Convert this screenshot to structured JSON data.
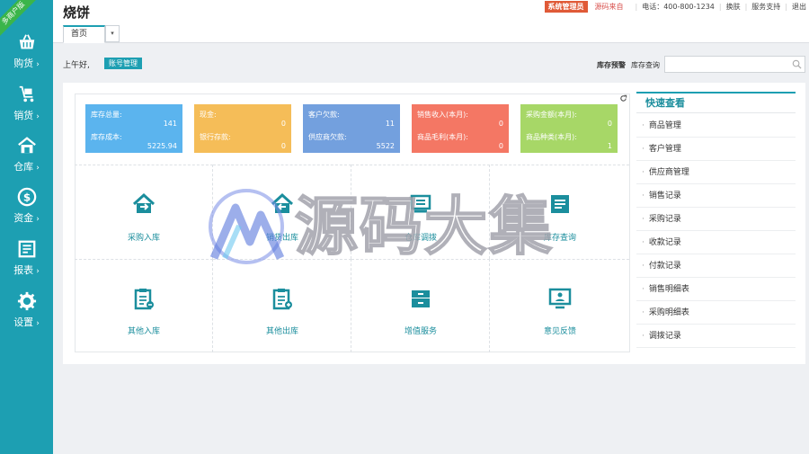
{
  "ribbon": "多商户版",
  "sidebar": {
    "items": [
      {
        "label": "购货",
        "icon": "basket-icon"
      },
      {
        "label": "销货",
        "icon": "cart-icon"
      },
      {
        "label": "仓库",
        "icon": "warehouse-icon"
      },
      {
        "label": "资金",
        "icon": "dollar-icon"
      },
      {
        "label": "报表",
        "icon": "report-icon"
      },
      {
        "label": "设置",
        "icon": "gear-icon"
      }
    ],
    "chevron": "›"
  },
  "header": {
    "title": "烧饼",
    "tab_home": "首页",
    "tab_dropdown": "▾",
    "badge": "系统管理员",
    "source": "源码来自",
    "phone": "电话：400-800-1234",
    "switch": "换肤",
    "support": "服务支持",
    "logout": "退出"
  },
  "greeting": {
    "text": "上午好,",
    "account_button": "账号管理",
    "stock_warning": "库存预警",
    "stock_query": "库存查询",
    "search_value": ""
  },
  "cards": [
    {
      "color": "#5bb4ee",
      "l1": "库存总量:",
      "v1": "141",
      "l2": "库存成本:",
      "v2": "5225.94"
    },
    {
      "color": "#f5bd58",
      "l1": "现金:",
      "v1": "0",
      "l2": "银行存款:",
      "v2": "0"
    },
    {
      "color": "#73a0de",
      "l1": "客户欠款:",
      "v1": "11",
      "l2": "供应商欠款:",
      "v2": "5522"
    },
    {
      "color": "#f47764",
      "l1": "销售收入(本月):",
      "v1": "0",
      "l2": "商品毛利(本月):",
      "v2": "0"
    },
    {
      "color": "#a7d767",
      "l1": "采购金额(本月):",
      "v1": "0",
      "l2": "商品种类(本月):",
      "v2": "1"
    }
  ],
  "grid": [
    {
      "label": "采购入库",
      "icon": "house-arrow-icon"
    },
    {
      "label": "销货出库",
      "icon": "house-out-icon"
    },
    {
      "label": "仓库调拨",
      "icon": "transfer-icon"
    },
    {
      "label": "库存查询",
      "icon": "stock-icon"
    },
    {
      "label": "其他入库",
      "icon": "clipboard-in-icon"
    },
    {
      "label": "其他出库",
      "icon": "clipboard-out-icon"
    },
    {
      "label": "增值服务",
      "icon": "cabinet-icon"
    },
    {
      "label": "意见反馈",
      "icon": "monitor-user-icon"
    }
  ],
  "quick_view": {
    "title": "快速查看",
    "items": [
      "商品管理",
      "客户管理",
      "供应商管理",
      "销售记录",
      "采购记录",
      "收款记录",
      "付款记录",
      "销售明细表",
      "采购明细表",
      "调拨记录"
    ]
  },
  "watermark": "源码大集",
  "colors": {
    "accent": "#1d9fb2",
    "teal_text": "#1b8e9d"
  }
}
